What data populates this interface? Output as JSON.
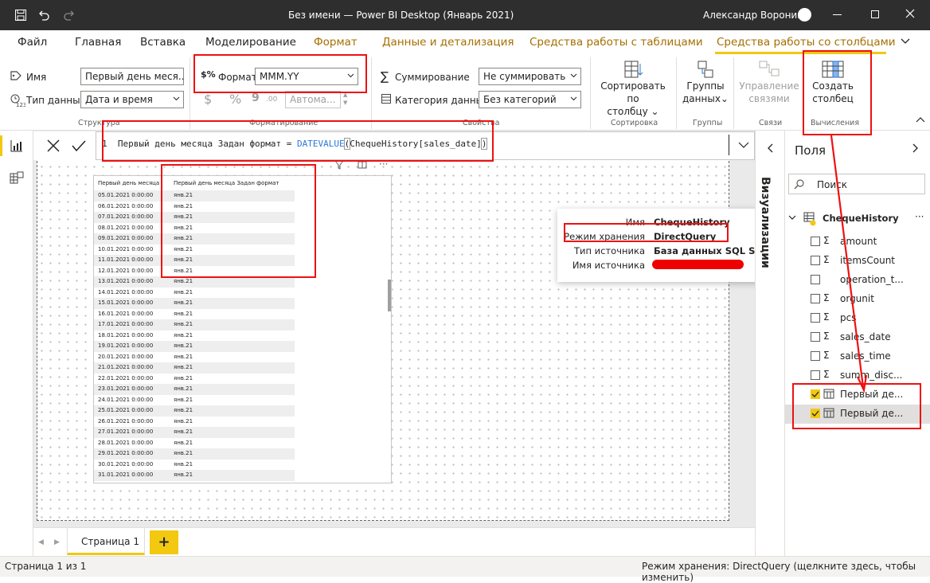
{
  "titlebar": {
    "title": "Без имени — Power BI Desktop (Январь 2021)",
    "user": "Александр Воронин"
  },
  "tabs": [
    {
      "label": "Файл"
    },
    {
      "label": "Главная"
    },
    {
      "label": "Вставка"
    },
    {
      "label": "Моделирование"
    },
    {
      "label": "Формат"
    },
    {
      "label": "Данные и детализация"
    },
    {
      "label": "Средства работы с таблицами"
    },
    {
      "label": "Средства работы со столбцами"
    }
  ],
  "ribbon": {
    "name_label": "Имя",
    "name_value": "Первый день меся...",
    "datatype_label": "Тип данных",
    "datatype_value": "Дата и время",
    "group_structure": "Структура",
    "format_label": "Формат",
    "format_value": "MMM.YY",
    "currency_symbol": "$",
    "percent_symbol": "%",
    "comma_symbol": "9",
    "auto_value": "Автома...",
    "group_formatting": "Форматирование",
    "summarize_label": "Суммирование",
    "summarize_value": "Не суммировать",
    "category_label": "Категория данных",
    "category_value": "Без категорий",
    "group_properties": "Свойства",
    "sort_label_1": "Сортировать по",
    "sort_label_2": "столбцу",
    "group_sort": "Сортировка",
    "groups_label_1": "Группы",
    "groups_label_2": "данных",
    "group_groups": "Группы",
    "relations_label_1": "Управление",
    "relations_label_2": "связями",
    "group_relations": "Связи",
    "newcol_label_1": "Создать",
    "newcol_label_2": "столбец",
    "group_calc": "Вычисления"
  },
  "formula": {
    "line_number": "1",
    "text_prefix": "Первый день месяца Задан формат = ",
    "func": "DATEVALUE",
    "open_paren": "(",
    "arg": "ChequeHistory[sales_date]",
    "close_paren": ")"
  },
  "table_visual": {
    "col1": "Первый день месяца",
    "col2": "Первый день месяца Задан формат",
    "rows": [
      [
        "05.01.2021 0:00:00",
        "янв.21"
      ],
      [
        "06.01.2021 0:00:00",
        "янв.21"
      ],
      [
        "07.01.2021 0:00:00",
        "янв.21"
      ],
      [
        "08.01.2021 0:00:00",
        "янв.21"
      ],
      [
        "09.01.2021 0:00:00",
        "янв.21"
      ],
      [
        "10.01.2021 0:00:00",
        "янв.21"
      ],
      [
        "11.01.2021 0:00:00",
        "янв.21"
      ],
      [
        "12.01.2021 0:00:00",
        "янв.21"
      ],
      [
        "13.01.2021 0:00:00",
        "янв.21"
      ],
      [
        "14.01.2021 0:00:00",
        "янв.21"
      ],
      [
        "15.01.2021 0:00:00",
        "янв.21"
      ],
      [
        "16.01.2021 0:00:00",
        "янв.21"
      ],
      [
        "17.01.2021 0:00:00",
        "янв.21"
      ],
      [
        "18.01.2021 0:00:00",
        "янв.21"
      ],
      [
        "19.01.2021 0:00:00",
        "янв.21"
      ],
      [
        "20.01.2021 0:00:00",
        "янв.21"
      ],
      [
        "21.01.2021 0:00:00",
        "янв.21"
      ],
      [
        "22.01.2021 0:00:00",
        "янв.21"
      ],
      [
        "23.01.2021 0:00:00",
        "янв.21"
      ],
      [
        "24.01.2021 0:00:00",
        "янв.21"
      ],
      [
        "25.01.2021 0:00:00",
        "янв.21"
      ],
      [
        "26.01.2021 0:00:00",
        "янв.21"
      ],
      [
        "27.01.2021 0:00:00",
        "янв.21"
      ],
      [
        "28.01.2021 0:00:00",
        "янв.21"
      ],
      [
        "29.01.2021 0:00:00",
        "янв.21"
      ],
      [
        "30.01.2021 0:00:00",
        "янв.21"
      ],
      [
        "31.01.2021 0:00:00",
        "янв.21"
      ]
    ]
  },
  "popup": {
    "k1": "Имя",
    "v1": "ChequeHistory",
    "k2": "Режим хранения",
    "v2": "DirectQuery",
    "k3": "Тип источника",
    "v3": "База данных SQL Server",
    "k4": "Имя источника"
  },
  "viz_pane": {
    "title": "Визуализации"
  },
  "fields_pane": {
    "title": "Поля",
    "search_placeholder": "Поиск",
    "table_name": "ChequeHistory",
    "more": "···",
    "items": [
      {
        "label": "amount",
        "sigma": "Σ",
        "checked": false
      },
      {
        "label": "itemsCount",
        "sigma": "Σ",
        "checked": false
      },
      {
        "label": "operation_t...",
        "sigma": "",
        "checked": false
      },
      {
        "label": "orgunit",
        "sigma": "Σ",
        "checked": false
      },
      {
        "label": "pcs",
        "sigma": "Σ",
        "checked": false
      },
      {
        "label": "sales_date",
        "sigma": "Σ",
        "checked": false
      },
      {
        "label": "sales_time",
        "sigma": "Σ",
        "checked": false
      },
      {
        "label": "summ_disc...",
        "sigma": "Σ",
        "checked": false
      },
      {
        "label": "Первый де...",
        "sigma": "",
        "checked": true
      },
      {
        "label": "Первый де...",
        "sigma": "",
        "checked": true
      }
    ]
  },
  "pagetabs": {
    "page1": "Страница 1",
    "add": "+"
  },
  "status": {
    "left": "Страница 1 из 1",
    "right": "Режим хранения: DirectQuery (щелкните здесь, чтобы изменить)"
  },
  "colors": {
    "accent": "#f2c811",
    "context_tab": "#a66f00",
    "annotation": "#e11111",
    "titlebar": "#2e2e2e"
  }
}
